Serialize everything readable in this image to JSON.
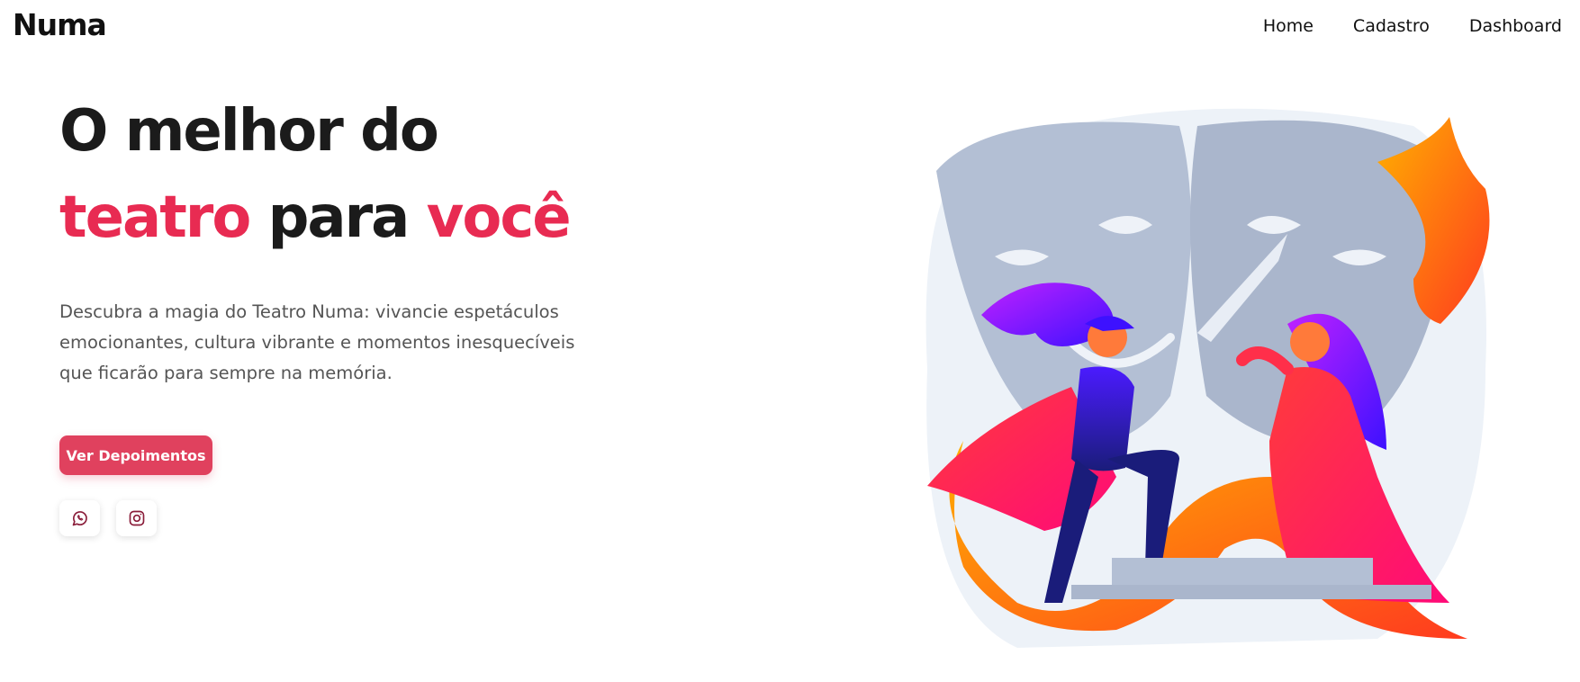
{
  "header": {
    "brand": "Numa",
    "nav": [
      "Home",
      "Cadastro",
      "Dashboard"
    ]
  },
  "hero": {
    "title_part1": "O melhor do",
    "title_accent1": "teatro",
    "title_mid": " para ",
    "title_accent2": "você",
    "description": "Descubra a magia do Teatro Numa: vivancie espetáculos emocionantes, cultura vibrante e momentos inesquecíveis que ficarão para sempre na memória.",
    "cta_label": "Ver Depoimentos"
  },
  "social": {
    "icons": [
      "whatsapp-icon",
      "instagram-icon"
    ]
  },
  "colors": {
    "accent": "#e82b52",
    "button": "#e0415e",
    "mask": "#b3bfd4",
    "orange": "#ff8a00",
    "purple": "#6a1bff"
  }
}
